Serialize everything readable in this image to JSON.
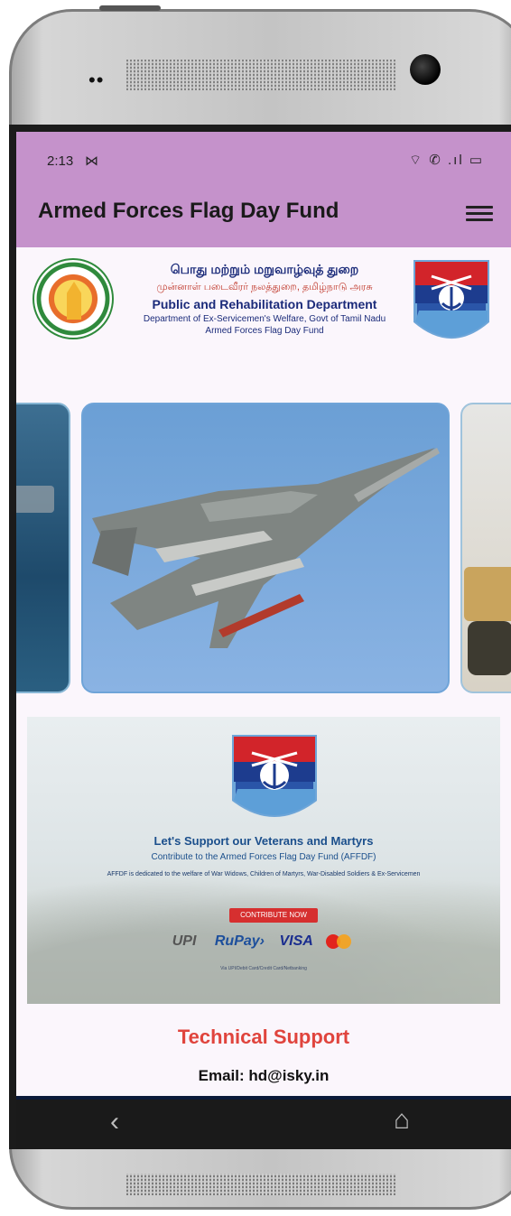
{
  "status_bar": {
    "time": "2:13",
    "notification_icon": "mail-icon",
    "right_icons": "wifi-icon call-icon signal-icon battery-icon",
    "right_glyphs": "⌔ ✆ .ıl ▭"
  },
  "app_bar": {
    "title": "Armed Forces Flag Day Fund",
    "menu_icon": "hamburger-menu-icon",
    "bg_color": "#c592cb"
  },
  "banner": {
    "line_tamil_1": "பொது மற்றும் மறுவாழ்வுத் துறை",
    "line_tamil_2": "முன்னாள் படைவீரர் நலத்துறை, தமிழ்நாடு அரசு",
    "line_dept": "Public and Rehabilitation Department",
    "line_dept_sub": "Department of Ex-Servicemen's Welfare, Govt of Tamil Nadu",
    "line_fund": "Armed Forces Flag Day Fund"
  },
  "carousel": {
    "slides": [
      "navy-ship-image",
      "fighter-jet-image",
      "army-tank-image"
    ],
    "active_index": 1
  },
  "contribute": {
    "headline": "Let's Support our Veterans and Martyrs",
    "subheadline": "Contribute to the Armed Forces Flag Day Fund (AFFDF)",
    "description": "AFFDF is dedicated to the welfare of War Widows, Children of Martyrs, War-Disabled Soldiers & Ex-Servicemen",
    "button_label": "CONTRIBUTE NOW",
    "payment_upi": "UPI",
    "payment_rupay": "RuPay›",
    "payment_visa": "VISA",
    "payment_methods_note": "Via UPI/Debit Card/Credit Card/Netbanking"
  },
  "support": {
    "title": "Technical Support",
    "email": "Email: hd@isky.in"
  },
  "nav": {
    "back_glyph": "‹",
    "home_glyph": "⌂"
  }
}
